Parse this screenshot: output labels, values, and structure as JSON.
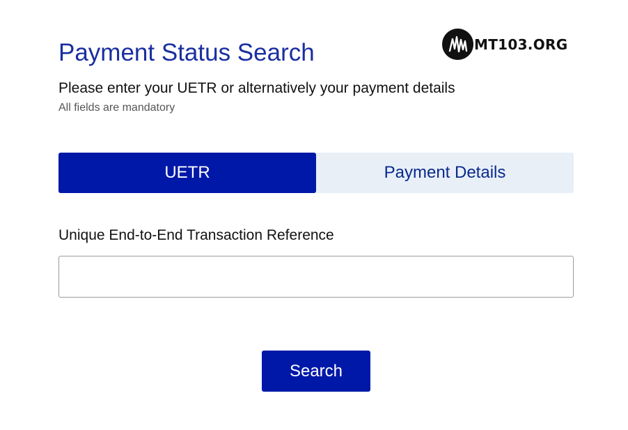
{
  "header": {
    "title": "Payment Status Search",
    "subtitle": "Please enter your UETR or alternatively your payment details",
    "hint": "All fields are mandatory"
  },
  "logo": {
    "text": "MT103.ORG",
    "icon": "waveform-m-logo"
  },
  "tabs": [
    {
      "label": "UETR",
      "active": true
    },
    {
      "label": "Payment Details",
      "active": false
    }
  ],
  "form": {
    "uetr_label": "Unique End-to-End Transaction Reference",
    "uetr_value": "",
    "uetr_placeholder": ""
  },
  "actions": {
    "search_label": "Search"
  },
  "colors": {
    "primary": "#0018a8",
    "title": "#1a2ea0",
    "inactive_tab_bg": "#e8eff7",
    "inactive_tab_text": "#0a2a8c"
  }
}
